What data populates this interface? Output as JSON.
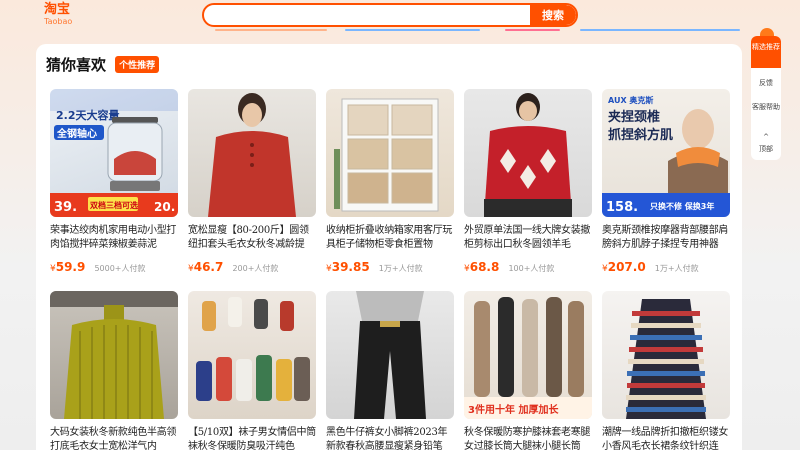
{
  "header": {
    "logo_cn": "淘宝",
    "logo_en": "Taobao",
    "search_placeholder": "",
    "search_button": "搜索"
  },
  "section": {
    "title": "猜你喜欢",
    "badge": "个性推荐"
  },
  "products": [
    {
      "title": "荣事达绞肉机家用电动小型打肉馅搅拌碎菜辣椒姜蒜泥",
      "price": "59.9",
      "currency": "¥",
      "sales": "5000+人付款",
      "image": "meat-grinder",
      "overlay_top": "2.2天大容量",
      "overlay_mid": "全钢轴心",
      "overlay_price": "39.",
      "overlay_tag": "双档三档可选",
      "overlay_right": "20."
    },
    {
      "title": "宽松显瘦【80-200斤】圆领纽扣套头毛衣女秋冬减龄提",
      "price": "46.7",
      "currency": "¥",
      "sales": "200+人付款",
      "image": "red-sweater"
    },
    {
      "title": "收纳柜折叠收纳箱家用客厅玩具柜子储物柜零食柜置物",
      "price": "39.85",
      "currency": "¥",
      "sales": "1万+人付款",
      "image": "storage-cabinet"
    },
    {
      "title": "外贸原单法国一线大牌女装撤柜剪标出口秋冬圆领羊毛",
      "price": "68.8",
      "currency": "¥",
      "sales": "100+人付款",
      "image": "pattern-sweater"
    },
    {
      "title": "奥克斯颈椎按摩器背部腰部肩膀斜方肌脖子揉捏专用神器",
      "price": "207.0",
      "currency": "¥",
      "sales": "1万+人付款",
      "image": "neck-massager",
      "overlay_brand": "AUX 奥克斯",
      "overlay_line1": "夹捏颈椎",
      "overlay_line2": "抓捏斜方肌",
      "overlay_price": "158.",
      "overlay_tag": "只换不修 保换3年"
    },
    {
      "title": "大码女装秋冬新款纯色半高领打底毛衣女士宽松洋气内",
      "price": "",
      "currency": "",
      "sales": "",
      "image": "yellow-turtleneck"
    },
    {
      "title": "【5/10双】袜子男女情侣中筒袜秋冬保暖防臭吸汗纯色",
      "price": "",
      "currency": "",
      "sales": "",
      "image": "socks"
    },
    {
      "title": "黑色牛仔裤女小脚裤2023年新款春秋高腰显瘦紧身铅笔",
      "price": "",
      "currency": "",
      "sales": "",
      "image": "black-jeans"
    },
    {
      "title": "秋冬保暖防寒护膝袜套老寒腿女过膝长筒大腿袜小腿长筒",
      "price": "",
      "currency": "",
      "sales": "",
      "image": "leg-warmers",
      "overlay_tag": "3件用十年 加厚加长"
    },
    {
      "title": "潮牌一线品牌折扣撤柜织镂女小香风毛衣长裙条纹针织连",
      "price": "",
      "currency": "",
      "sales": "",
      "image": "striped-dress"
    }
  ],
  "rail": {
    "items": [
      "精选推荐",
      "反馈",
      "客服帮助",
      "顶部"
    ]
  },
  "colors": {
    "accent": "#ff5000",
    "price": "#ff5000"
  }
}
